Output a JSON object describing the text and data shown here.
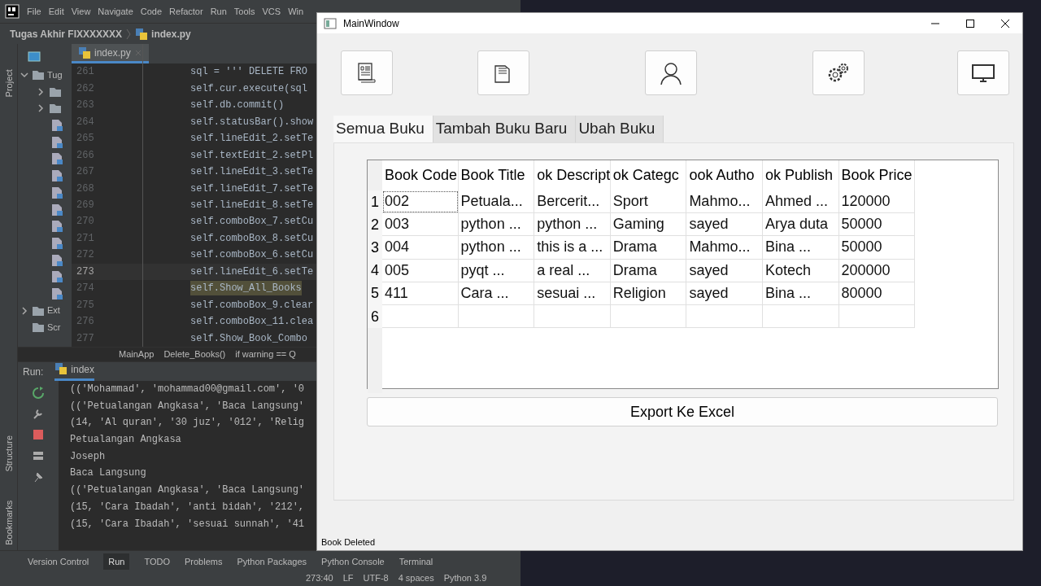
{
  "ide": {
    "menu": [
      "File",
      "Edit",
      "View",
      "Navigate",
      "Code",
      "Refactor",
      "Run",
      "Tools",
      "VCS",
      "Win"
    ],
    "breadcrumb": {
      "project": "Tugas Akhir FIXXXXXXX",
      "file": "index.py"
    },
    "editor_tab": "index.py",
    "side_tabs": [
      "Project",
      "Structure",
      "Bookmarks"
    ],
    "project_tree": [
      {
        "label": "Tug",
        "expanded": true,
        "children": [
          {
            "kind": "folder",
            "expanded": false
          },
          {
            "kind": "folder",
            "expanded": false
          },
          {
            "kind": "file"
          },
          {
            "kind": "file"
          },
          {
            "kind": "file"
          },
          {
            "kind": "file"
          },
          {
            "kind": "file"
          },
          {
            "kind": "file"
          },
          {
            "kind": "file"
          },
          {
            "kind": "file"
          },
          {
            "kind": "file"
          },
          {
            "kind": "file"
          },
          {
            "kind": "file"
          }
        ]
      },
      {
        "label": "Ext",
        "expanded": false
      },
      {
        "label": "Scr"
      }
    ],
    "code_lines": [
      {
        "number": "261",
        "text": "sql = '''  DELETE FRO",
        "current": false,
        "highlighted": false
      },
      {
        "number": "262",
        "text": "self.cur.execute(sql",
        "current": false,
        "highlighted": false
      },
      {
        "number": "263",
        "text": "self.db.commit()",
        "current": false,
        "highlighted": false
      },
      {
        "number": "264",
        "text": "self.statusBar().show",
        "current": false,
        "highlighted": false
      },
      {
        "number": "265",
        "text": "self.lineEdit_2.setTe",
        "current": false,
        "highlighted": false
      },
      {
        "number": "266",
        "text": "self.textEdit_2.setPl",
        "current": false,
        "highlighted": false
      },
      {
        "number": "267",
        "text": "self.lineEdit_3.setTe",
        "current": false,
        "highlighted": false
      },
      {
        "number": "268",
        "text": "self.lineEdit_7.setTe",
        "current": false,
        "highlighted": false
      },
      {
        "number": "269",
        "text": "self.lineEdit_8.setTe",
        "current": false,
        "highlighted": false
      },
      {
        "number": "270",
        "text": "self.comboBox_7.setCu",
        "current": false,
        "highlighted": false
      },
      {
        "number": "271",
        "text": "self.comboBox_8.setCu",
        "current": false,
        "highlighted": false
      },
      {
        "number": "272",
        "text": "self.comboBox_6.setCu",
        "current": false,
        "highlighted": false
      },
      {
        "number": "273",
        "text": "self.lineEdit_6.setTe",
        "current": true,
        "highlighted": false
      },
      {
        "number": "274",
        "text": "self.Show_All_Books",
        "current": false,
        "highlighted": true
      },
      {
        "number": "275",
        "text": "self.comboBox_9.clear",
        "current": false,
        "highlighted": false
      },
      {
        "number": "276",
        "text": "self.comboBox_11.clea",
        "current": false,
        "highlighted": false
      },
      {
        "number": "277",
        "text": "self.Show_Book_Combo",
        "current": false,
        "highlighted": false
      }
    ],
    "code_path": [
      "MainApp",
      "Delete_Books()",
      "if warning == Q"
    ],
    "run": {
      "label": "Run:",
      "tab": "index",
      "output": [
        "(('Mohammad', 'mohammad00@gmail.com', '0",
        "(('Petualangan Angkasa', 'Baca Langsung'",
        "(14, 'Al quran', '30 juz', '012', 'Relig",
        "Petualangan Angkasa",
        "Joseph",
        "Baca Langsung",
        "(('Petualangan Angkasa', 'Baca Langsung'",
        "(15, 'Cara Ibadah', 'anti bidah', '212',",
        "(15, 'Cara Ibadah', 'sesuai sunnah', '41"
      ]
    },
    "tool_windows": [
      {
        "label": "Version Control",
        "selected": false
      },
      {
        "label": "Run",
        "selected": true
      },
      {
        "label": "TODO",
        "selected": false
      },
      {
        "label": "Problems",
        "selected": false
      },
      {
        "label": "Python Packages",
        "selected": false
      },
      {
        "label": "Python Console",
        "selected": false
      },
      {
        "label": "Terminal",
        "selected": false
      }
    ],
    "status": [
      "273:40",
      "LF",
      "UTF-8",
      "4 spaces",
      "Python 3.9"
    ]
  },
  "window": {
    "title": "MainWindow",
    "tabs": [
      {
        "label": "Semua Buku",
        "selected": true
      },
      {
        "label": "Tambah Buku Baru",
        "selected": false
      },
      {
        "label": "Ubah Buku",
        "selected": false
      }
    ],
    "table": {
      "columns": [
        "Book Code",
        "Book Title",
        "ok Descript",
        "ok Categc",
        "ook Autho",
        "ok Publish",
        "Book Price"
      ],
      "rows": [
        {
          "header": "1",
          "cells": [
            "002",
            "Petuala...",
            "Bercerit...",
            "Sport",
            "Mahmo...",
            "Ahmed ...",
            "120000"
          ]
        },
        {
          "header": "2",
          "cells": [
            "003",
            "python ...",
            "python ...",
            "Gaming",
            "sayed",
            "Arya duta",
            "50000"
          ]
        },
        {
          "header": "3",
          "cells": [
            "004",
            "python ...",
            "this is a ...",
            "Drama",
            "Mahmo...",
            "Bina ...",
            "50000"
          ]
        },
        {
          "header": "4",
          "cells": [
            "005",
            "pyqt ...",
            "a real ...",
            "Drama",
            "sayed",
            "Kotech",
            "200000"
          ]
        },
        {
          "header": "5",
          "cells": [
            "411",
            "Cara ...",
            "sesuai ...",
            "Religion",
            "sayed",
            "Bina ...",
            "80000"
          ]
        },
        {
          "header": "6"
        }
      ]
    },
    "export_button": "Export Ke Excel",
    "status_message": "Book Deleted"
  }
}
